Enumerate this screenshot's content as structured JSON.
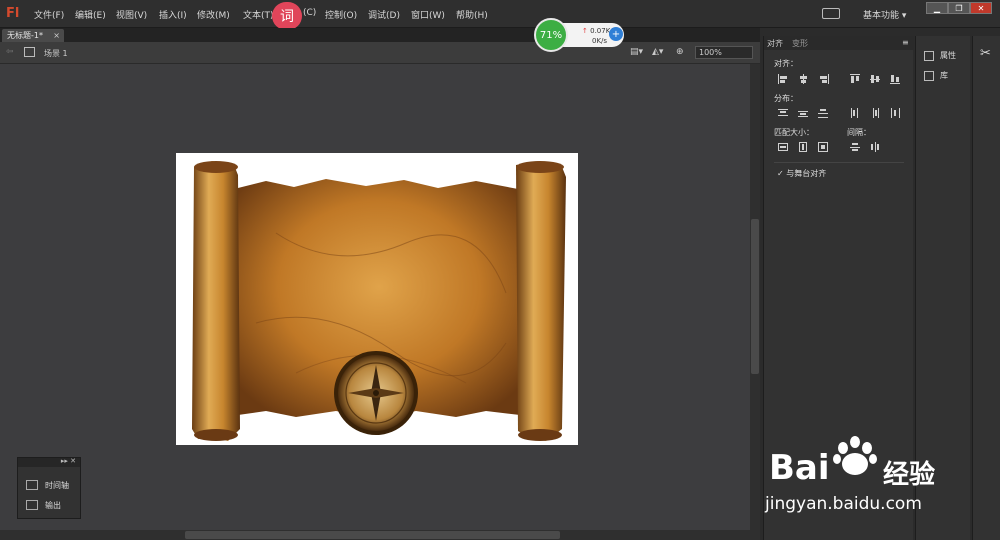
{
  "app": {
    "logo": "Fl",
    "menu": [
      "文件(F)",
      "编辑(E)",
      "视图(V)",
      "插入(I)",
      "修改(M)",
      "文本(T)",
      "(C)",
      "控制(O)",
      "调试(D)",
      "窗口(W)",
      "帮助(H)"
    ],
    "dict_badge": "词",
    "workspace": "基本功能",
    "window_buttons": [
      "▁",
      "❐",
      "✕"
    ]
  },
  "document": {
    "tab_label": "无标题-1*",
    "tab_close": "×",
    "scene_label": "场景 1",
    "zoom": "100%"
  },
  "net_widget": {
    "percent": "71%",
    "up": "0.07K/s",
    "down": "0K/s",
    "plus": "+"
  },
  "align_panel": {
    "tabs": [
      "对齐",
      "变形"
    ],
    "sections": {
      "align": "对齐：",
      "distribute": "分布：",
      "match_size": "匹配大小：",
      "spacing": "间隔："
    },
    "stage_align": "与舞台对齐",
    "stage_align_checked": true
  },
  "property_panel": {
    "items": [
      "属性",
      "库"
    ]
  },
  "floating_panel": {
    "items": [
      "时间轴",
      "输出"
    ]
  },
  "watermark": {
    "logo_text": "Bai",
    "logo_suffix": "经验",
    "url": "jingyan.baidu.com"
  },
  "colors": {
    "accent": "#d44a2d",
    "net_green": "#3cae43",
    "dict_red": "#e0455a"
  }
}
